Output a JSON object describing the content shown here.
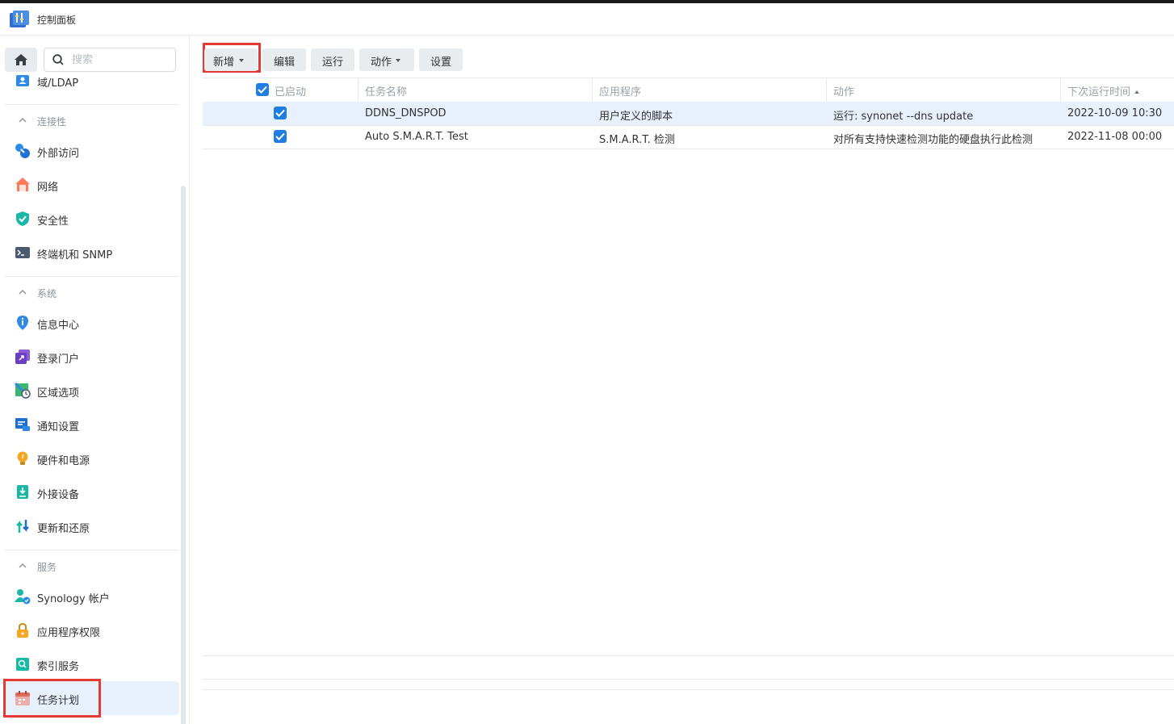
{
  "window": {
    "title": "控制面板"
  },
  "search": {
    "placeholder": "搜索"
  },
  "sidebar": {
    "top_item": {
      "label": "域/LDAP",
      "icon": "user-card-icon"
    },
    "sections": [
      {
        "title": "连接性",
        "items": [
          {
            "label": "外部访问",
            "icon": "external-access-icon"
          },
          {
            "label": "网络",
            "icon": "network-house-icon"
          },
          {
            "label": "安全性",
            "icon": "shield-icon"
          },
          {
            "label": "终端机和 SNMP",
            "icon": "terminal-icon"
          }
        ]
      },
      {
        "title": "系统",
        "items": [
          {
            "label": "信息中心",
            "icon": "info-icon"
          },
          {
            "label": "登录门户",
            "icon": "login-portal-icon"
          },
          {
            "label": "区域选项",
            "icon": "region-icon"
          },
          {
            "label": "通知设置",
            "icon": "notification-icon"
          },
          {
            "label": "硬件和电源",
            "icon": "lightbulb-icon"
          },
          {
            "label": "外接设备",
            "icon": "external-device-icon"
          },
          {
            "label": "更新和还原",
            "icon": "update-restore-icon"
          }
        ]
      },
      {
        "title": "服务",
        "items": [
          {
            "label": "Synology 帐户",
            "icon": "synology-account-icon"
          },
          {
            "label": "应用程序权限",
            "icon": "lock-icon"
          },
          {
            "label": "索引服务",
            "icon": "index-service-icon"
          },
          {
            "label": "任务计划",
            "icon": "calendar-icon",
            "active": true
          }
        ]
      }
    ]
  },
  "toolbar": {
    "new_label": "新增",
    "edit_label": "编辑",
    "run_label": "运行",
    "action_label": "动作",
    "settings_label": "设置"
  },
  "grid": {
    "columns": {
      "enabled": "已启动",
      "task_name": "任务名称",
      "application": "应用程序",
      "action": "动作",
      "next_run": "下次运行时间"
    },
    "rows": [
      {
        "enabled": true,
        "task_name": "DDNS_DNSPOD",
        "application": "用户定义的脚本",
        "action": "运行: synonet --dns update",
        "next_run": "2022-10-09 10:30"
      },
      {
        "enabled": true,
        "task_name": "Auto S.M.A.R.T. Test",
        "application": "S.M.A.R.T. 检测",
        "action": "对所有支持快速检测功能的硬盘执行此检测",
        "next_run": "2022-11-08 00:00"
      }
    ]
  },
  "colors": {
    "accent": "#1f7de3",
    "highlight": "#e53935",
    "selected_row": "#e7f0fb"
  }
}
